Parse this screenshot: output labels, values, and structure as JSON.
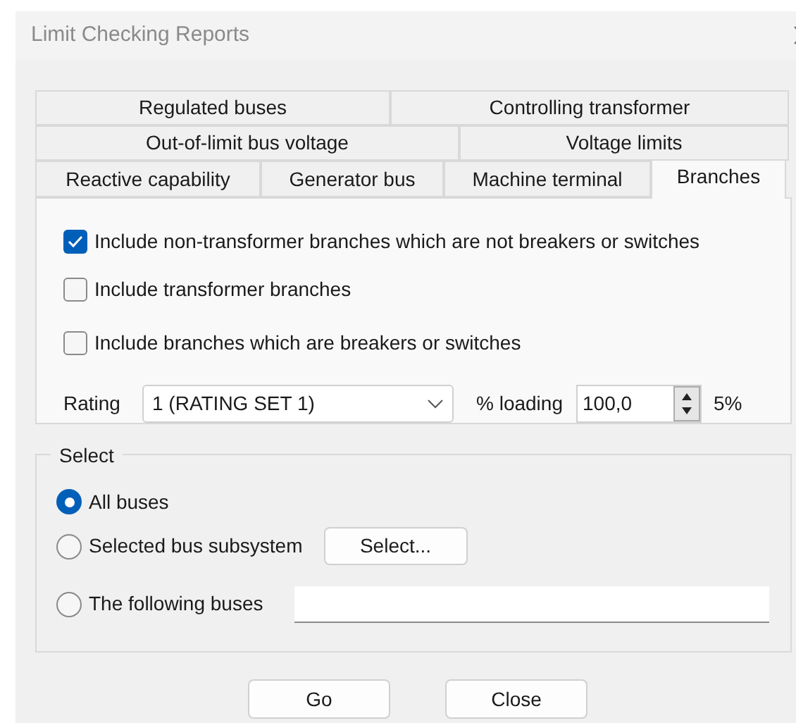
{
  "window": {
    "title": "Limit Checking Reports"
  },
  "tab_rows": [
    [
      {
        "label": "Regulated buses",
        "selected": false
      },
      {
        "label": "Controlling transformer",
        "selected": false
      }
    ],
    [
      {
        "label": "Out-of-limit bus voltage",
        "selected": false
      },
      {
        "label": "Voltage limits",
        "selected": false
      }
    ],
    [
      {
        "label": "Reactive capability",
        "selected": false
      },
      {
        "label": "Generator bus",
        "selected": false
      },
      {
        "label": "Machine terminal",
        "selected": false
      },
      {
        "label": "Branches",
        "selected": true
      }
    ]
  ],
  "options": [
    {
      "label": "Include non-transformer branches which are not breakers or switches",
      "checked": true
    },
    {
      "label": "Include transformer branches",
      "checked": false
    },
    {
      "label": "Include branches which are breakers or switches",
      "checked": false
    }
  ],
  "rating": {
    "label": "Rating",
    "value": "1 (RATING SET 1)"
  },
  "loading": {
    "label": "% loading",
    "value": "100,0",
    "suffix": "5%"
  },
  "select_group": {
    "title": "Select",
    "options": [
      {
        "label": "All buses",
        "selected": true,
        "kind": "plain"
      },
      {
        "label": "Selected bus subsystem",
        "selected": false,
        "kind": "button",
        "button": "Select..."
      },
      {
        "label": "The following buses",
        "selected": false,
        "kind": "field"
      }
    ]
  },
  "buttons": [
    "Go",
    "Close"
  ]
}
